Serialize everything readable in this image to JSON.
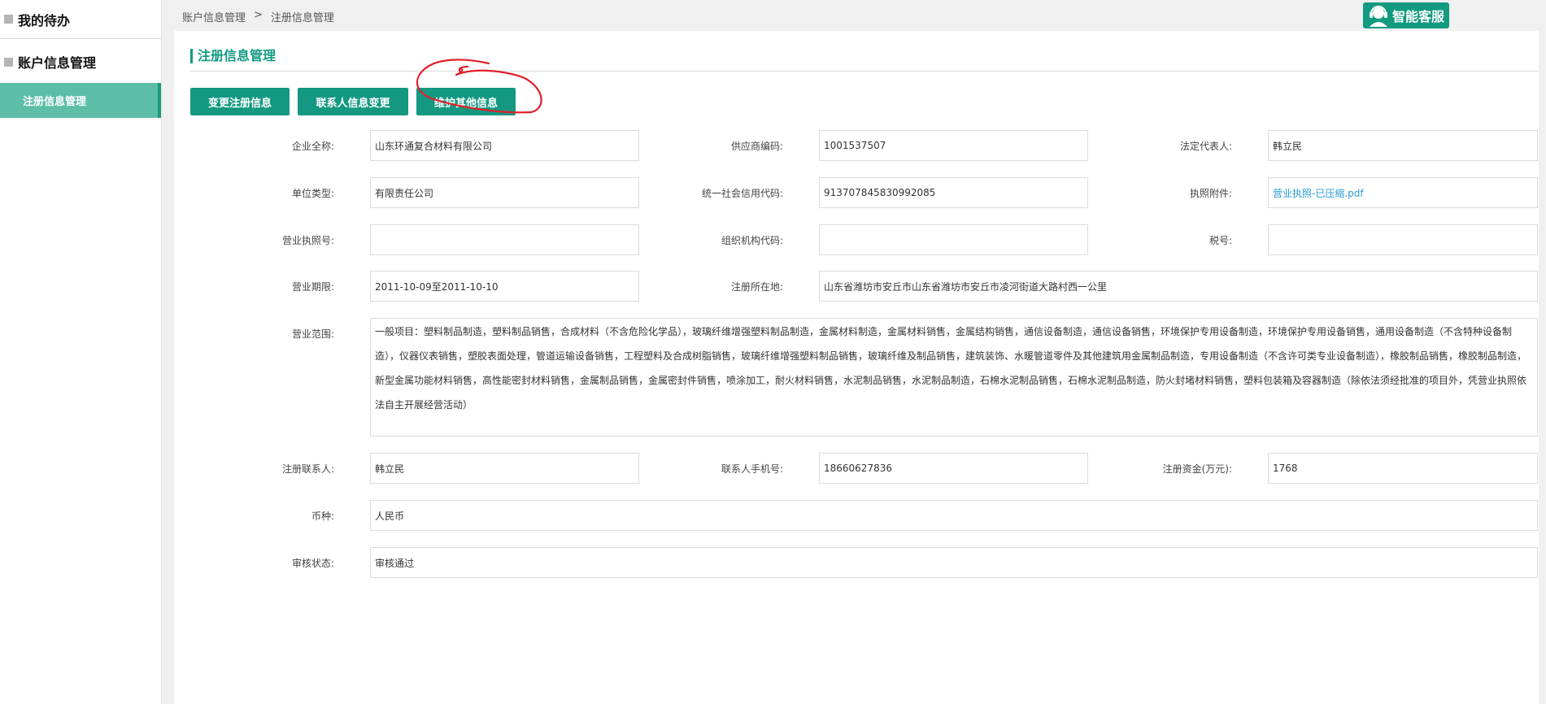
{
  "sidebar": {
    "group1": "我的待办",
    "group2": "账户信息管理",
    "active_item": "注册信息管理"
  },
  "breadcrumb": {
    "root": "账户信息管理",
    "separator": ">",
    "current": "注册信息管理"
  },
  "service": {
    "label": "智能客服"
  },
  "page": {
    "title": "注册信息管理"
  },
  "actions": {
    "change_registration": "变更注册信息",
    "change_contact": "联系人信息变更",
    "maintain_other": "维护其他信息"
  },
  "form": {
    "company_name_label": "企业全称:",
    "company_name": "山东环通复合材料有限公司",
    "supplier_code_label": "供应商编码:",
    "supplier_code": "1001537507",
    "legal_rep_label": "法定代表人:",
    "legal_rep": "韩立民",
    "unit_type_label": "单位类型:",
    "unit_type": "有限责任公司",
    "credit_code_label": "统一社会信用代码:",
    "credit_code": "913707845830992085",
    "license_attach_label": "执照附件:",
    "license_attach": "营业执照-已压缩.pdf",
    "license_no_label": "营业执照号:",
    "license_no": "",
    "org_code_label": "组织机构代码:",
    "org_code": "",
    "tax_no_label": "税号:",
    "tax_no": "",
    "period_label": "营业期限:",
    "period": "2011-10-09至2011-10-10",
    "reg_address_label": "注册所在地:",
    "reg_address": "山东省潍坊市安丘市山东省潍坊市安丘市凌河街道大路村西一公里",
    "scope_label": "营业范围:",
    "scope": "一般项目：塑料制品制造，塑料制品销售，合成材料（不含危险化学品），玻璃纤维增强塑料制品制造，金属材料制造，金属材料销售，金属结构销售，通信设备制造，通信设备销售，环境保护专用设备制造，环境保护专用设备销售，通用设备制造（不含特种设备制造），仪器仪表销售，塑胶表面处理，管道运输设备销售，工程塑料及合成树脂销售，玻璃纤维增强塑料制品销售，玻璃纤维及制品销售，建筑装饰、水暖管道零件及其他建筑用金属制品制造，专用设备制造（不含许可类专业设备制造），橡胶制品销售，橡胶制品制造，新型金属功能材料销售，高性能密封材料销售，金属制品销售，金属密封件销售，喷涂加工，耐火材料销售，水泥制品销售，水泥制品制造，石棉水泥制品销售，石棉水泥制品制造，防火封堵材料销售，塑料包装箱及容器制造（除依法须经批准的项目外，凭营业执照依法自主开展经营活动）",
    "reg_contact_label": "注册联系人:",
    "reg_contact": "韩立民",
    "contact_phone_label": "联系人手机号:",
    "contact_phone": "18660627836",
    "capital_label": "注册资金(万元):",
    "capital": "1768",
    "currency_label": "币种:",
    "currency": "人民币",
    "audit_status_label": "审核状态:",
    "audit_status": "审核通过"
  },
  "colors": {
    "accent": "#129a81",
    "sidebar_active": "#5cbea7",
    "link": "#2a9bd6",
    "annotation": "#e0202a"
  }
}
